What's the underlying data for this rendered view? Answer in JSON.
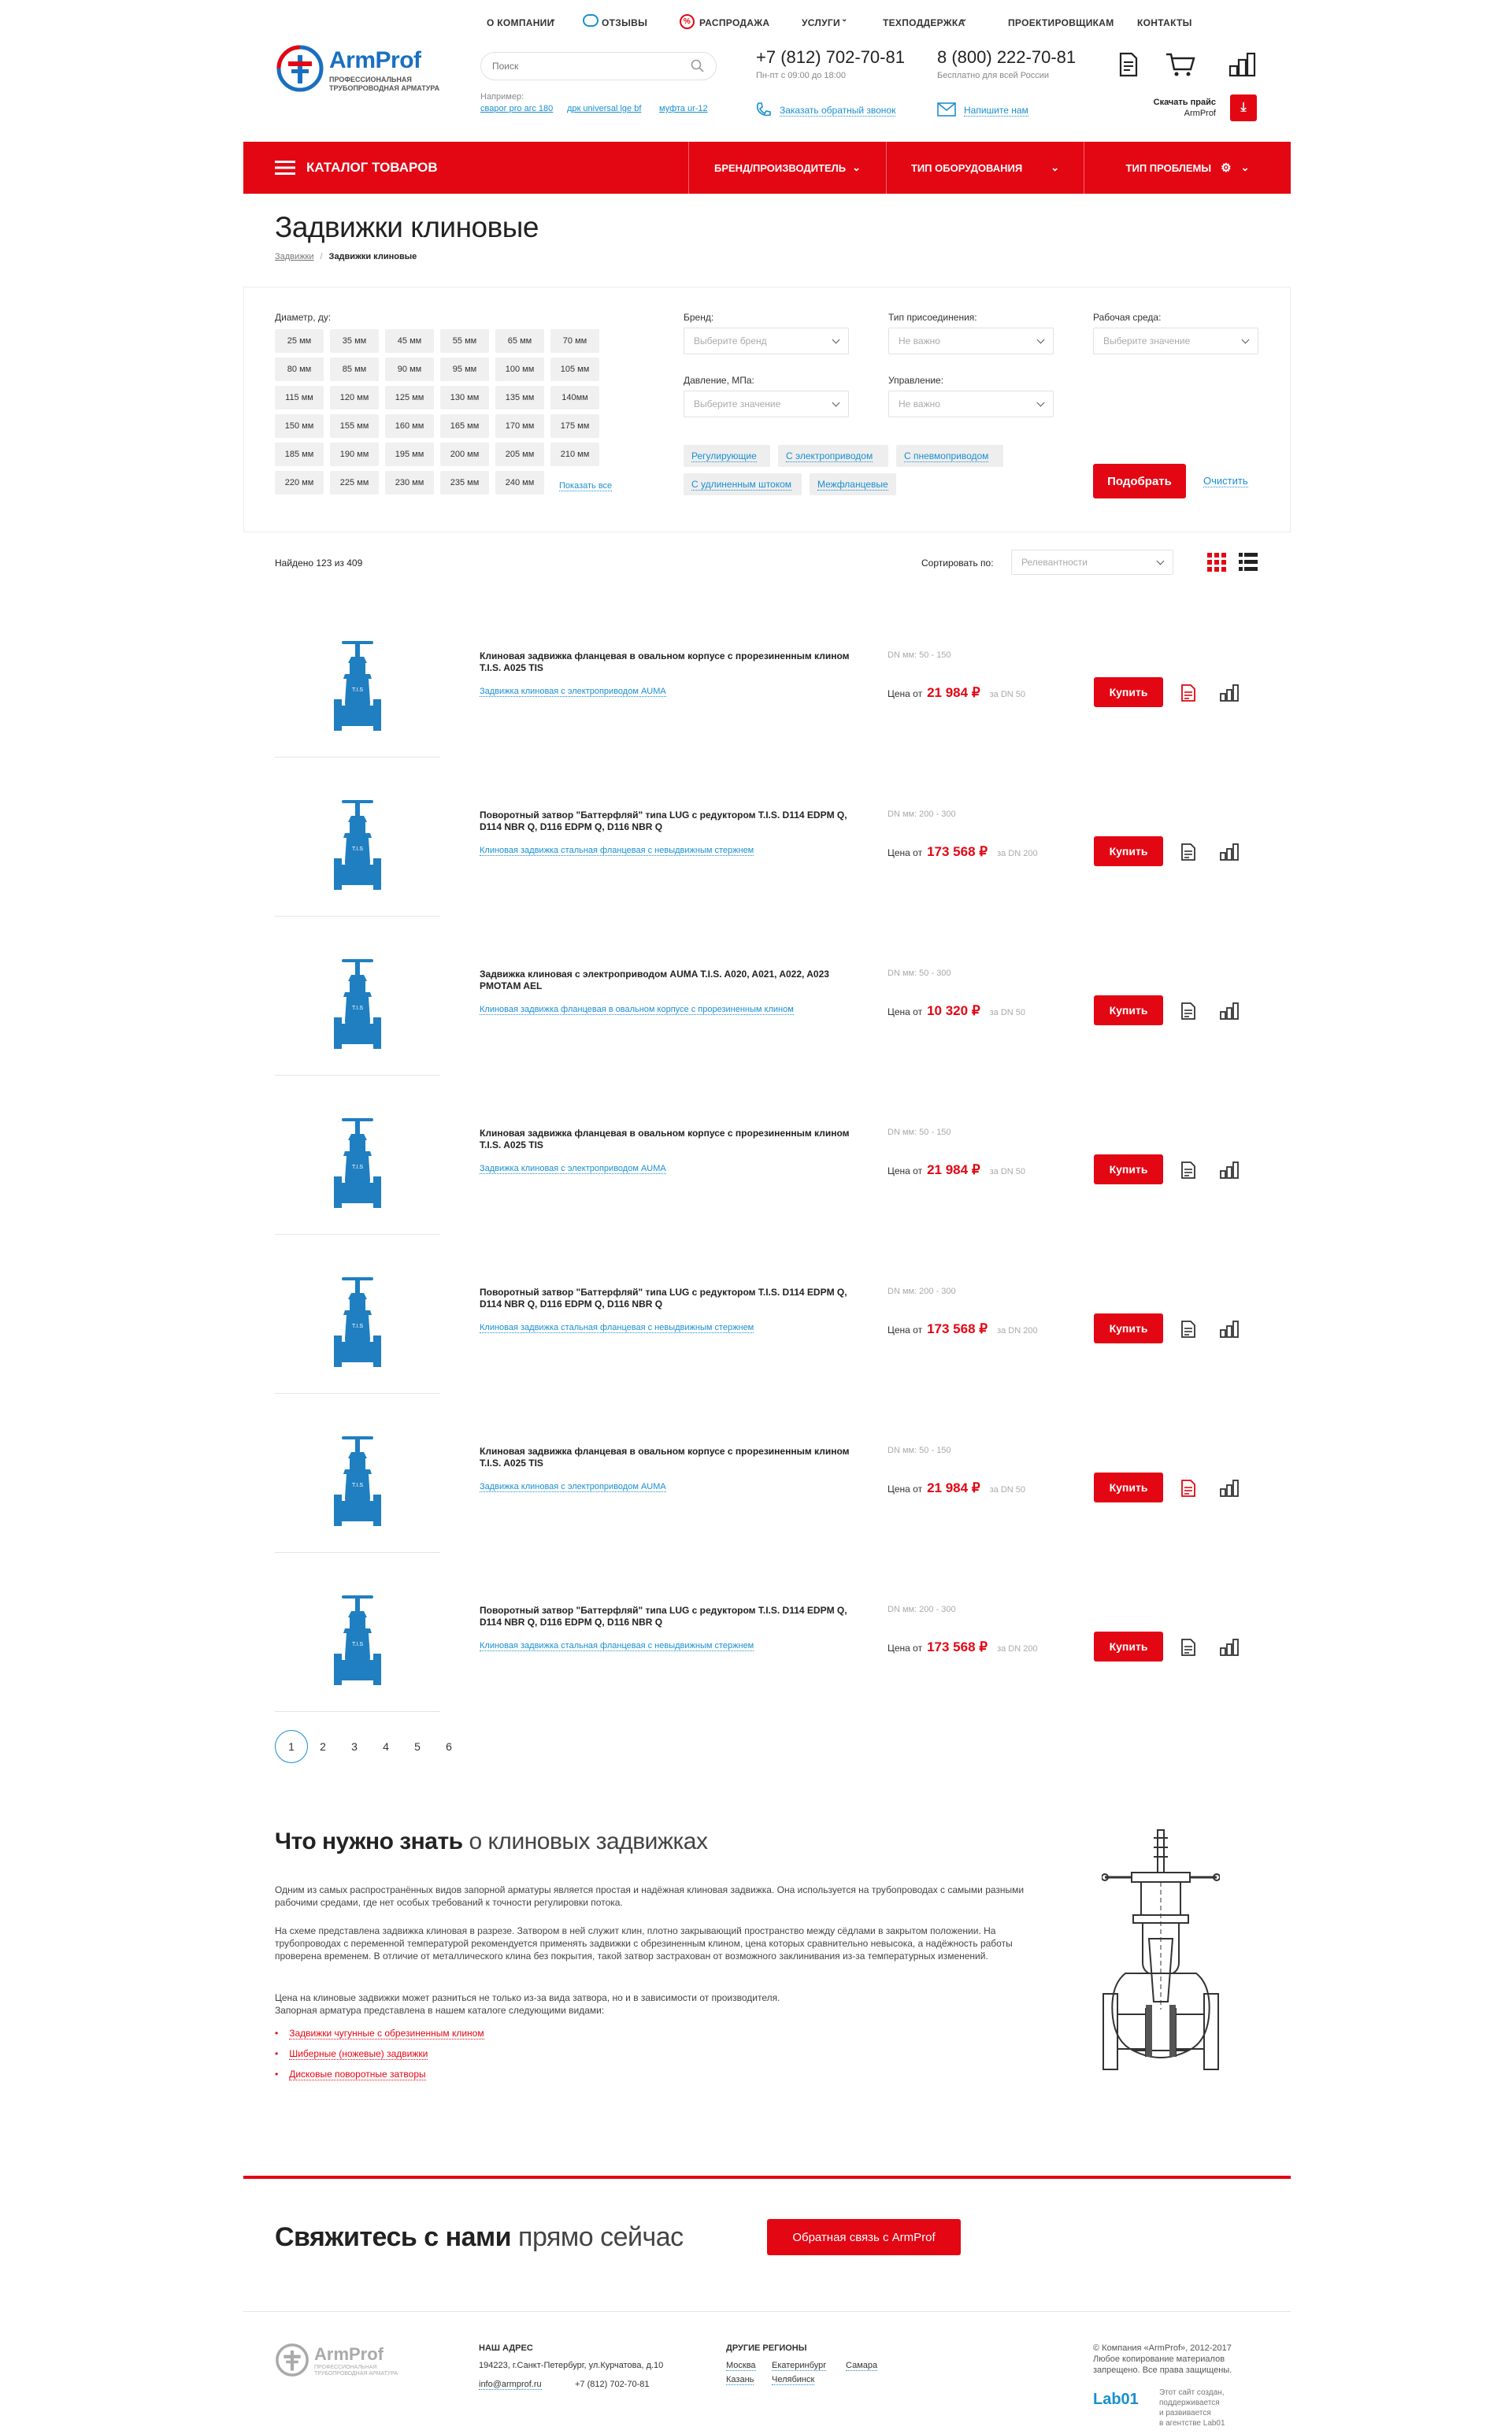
{
  "header": {
    "logo_text": "ArmProf",
    "logo_tagline_1": "ПРОФЕССИОНАЛЬНАЯ",
    "logo_tagline_2": "ТРУБОПРОВОДНАЯ АРМАТУРА",
    "topnav": [
      "О КОМПАНИИ",
      "ОТЗЫВЫ",
      "РАСПРОДАЖА",
      "УСЛУГИ",
      "ТЕХПОДДЕРЖКА",
      "ПРОЕКТИРОВЩИКАМ",
      "КОНТАКТЫ"
    ],
    "search_placeholder": "Поиск",
    "search_example_label": "Например:",
    "search_examples": [
      "сварог pro arc 180",
      "дрк universal lge bf",
      "муфта ur-12"
    ],
    "phone1": "+7 (812) 702-70-81",
    "phone1_hours": "Пн-пт с 09:00 до 18:00",
    "phone2": "8 (800) 222-70-81",
    "phone2_note": "Бесплатно для всей России",
    "callback": "Заказать обратный звонок",
    "write_us": "Напишите нам",
    "pricelist_1": "Скачать прайс",
    "pricelist_2": "ArmProf"
  },
  "menubar": {
    "catalog": "КАТАЛОГ ТОВАРОВ",
    "brand": "БРЕНД/ПРОИЗВОДИТЕЛЬ",
    "equipment": "ТИП ОБОРУДОВАНИЯ",
    "problem": "ТИП ПРОБЛЕМЫ"
  },
  "page": {
    "title": "Задвижки клиновые",
    "breadcrumb_1": "Задвижки",
    "breadcrumb_sep": "/",
    "breadcrumb_2": "Задвижки клиновые"
  },
  "filter": {
    "diameter_label": "Диаметр, ду:",
    "diameters": [
      "25 мм",
      "35 мм",
      "45 мм",
      "55 мм",
      "65 мм",
      "70 мм",
      "80 мм",
      "85 мм",
      "90 мм",
      "95 мм",
      "100 мм",
      "105 мм",
      "115 мм",
      "120 мм",
      "125 мм",
      "130 мм",
      "135 мм",
      "140мм",
      "150 мм",
      "155 мм",
      "160 мм",
      "165 мм",
      "170 мм",
      "175 мм",
      "185 мм",
      "190 мм",
      "195 мм",
      "200 мм",
      "205 мм",
      "210 мм",
      "220 мм",
      "225 мм",
      "230 мм",
      "235 мм",
      "240 мм"
    ],
    "show_all": "Показать все",
    "brand_label": "Бренд:",
    "brand_value": "Выберите бренд",
    "connection_label": "Тип присоединения:",
    "connection_value": "Не важно",
    "medium_label": "Рабочая среда:",
    "medium_value": "Выберите значение",
    "pressure_label": "Давление, МПа:",
    "pressure_value": "Выберите значение",
    "control_label": "Управление:",
    "control_value": "Не важно",
    "tags": [
      "Регулирующие",
      "С электроприводом",
      "С пневмоприводом",
      "С удлиненным штоком",
      "Межфланцевые"
    ],
    "submit": "Подобрать",
    "clear": "Очистить"
  },
  "results": {
    "found": "Найдено 123 из 409",
    "sort_label": "Сортировать по:",
    "sort_value": "Релевантности"
  },
  "products": [
    {
      "name": "Клиновая задвижка фланцевая в овальном корпусе с прорезиненным клином T.I.S. A025 TIS",
      "sub": "Задвижка клиновая с электроприводом AUMA",
      "dn": "DN мм: 50 - 150",
      "price_label": "Цена от",
      "price": "21 984 ₽",
      "per": "за DN 50",
      "buy": "Купить",
      "doc_color": "#e30613"
    },
    {
      "name": "Поворотный затвор \"Баттерфляй\" типа LUG с редуктором T.I.S. D114 EDPM Q, D114 NBR Q, D116 EDPM Q, D116 NBR Q",
      "sub": "Клиновая задвижка стальная фланцевая с невыдвижным стержнем",
      "dn": "DN мм: 200 - 300",
      "price_label": "Цена от",
      "price": "173 568 ₽",
      "per": "за DN 200",
      "buy": "Купить",
      "doc_color": "#333"
    },
    {
      "name": "Задвижка клиновая с электроприводом AUMA T.I.S. A020, A021, A022, A023 PMOTAM AEL",
      "sub": "Клиновая задвижка фланцевая в овальном корпусе с прорезиненным клином",
      "dn": "DN мм: 50 - 300",
      "price_label": "Цена от",
      "price": "10 320 ₽",
      "per": "за DN 50",
      "buy": "Купить",
      "doc_color": "#333"
    },
    {
      "name": "Клиновая задвижка фланцевая в овальном корпусе с прорезиненным клином T.I.S. A025 TIS",
      "sub": "Задвижка клиновая с электроприводом AUMA",
      "dn": "DN мм: 50 - 150",
      "price_label": "Цена от",
      "price": "21 984 ₽",
      "per": "за DN 50",
      "buy": "Купить",
      "doc_color": "#333"
    },
    {
      "name": "Поворотный затвор \"Баттерфляй\" типа LUG с редуктором T.I.S. D114 EDPM Q, D114 NBR Q, D116 EDPM Q, D116 NBR Q",
      "sub": "Клиновая задвижка стальная фланцевая с невыдвижным стержнем",
      "dn": "DN мм: 200 - 300",
      "price_label": "Цена от",
      "price": "173 568 ₽",
      "per": "за DN 200",
      "buy": "Купить",
      "doc_color": "#333"
    },
    {
      "name": "Клиновая задвижка фланцевая в овальном корпусе с прорезиненным клином T.I.S. A025 TIS",
      "sub": "Задвижка клиновая с электроприводом AUMA",
      "dn": "DN мм: 50 - 150",
      "price_label": "Цена от",
      "price": "21 984 ₽",
      "per": "за DN 50",
      "buy": "Купить",
      "doc_color": "#e30613"
    },
    {
      "name": "Поворотный затвор \"Баттерфляй\" типа LUG с редуктором T.I.S. D114 EDPM Q, D114 NBR Q, D116 EDPM Q, D116 NBR Q",
      "sub": "Клиновая задвижка стальная фланцевая с невыдвижным стержнем",
      "dn": "DN мм: 200 - 300",
      "price_label": "Цена от",
      "price": "173 568 ₽",
      "per": "за DN 200",
      "buy": "Купить",
      "doc_color": "#333"
    }
  ],
  "pagination": [
    "1",
    "2",
    "3",
    "4",
    "5",
    "6"
  ],
  "info": {
    "title_bold": "Что нужно знать",
    "title_light": "о клиновых задвижках",
    "p1": "Одним из самых распространённых видов запорной арматуры является простая и надёжная клиновая задвижка. Она используется на трубопроводах с самыми разными рабочими средами, где нет особых требований к точности регулировки потока.",
    "p2": "На схеме представлена задвижка клиновая в разрезе. Затвором в ней служит клин, плотно закрывающий пространство между сёдлами в закрытом положении. На трубопроводах с переменной температурой рекомендуется применять задвижки с обрезиненным клином, цена которых сравнительно невысока, а надёжность работы проверена временем. В отличие от металлического клина без покрытия, такой затвор застрахован от возможного заклинивания из-за температурных изменений.",
    "p3a": "Цена на клиновые задвижки может разниться не только из-за вида затвора, но и в зависимости от производителя.",
    "p3b": "Запорная арматура представлена в нашем каталоге следующими видами:",
    "links": [
      "Задвижки чугунные с обрезиненным клином",
      "Шиберные (ножевые) задвижки",
      "Дисковые поворотные затворы"
    ]
  },
  "contact": {
    "title_bold": "Свяжитесь с нами",
    "title_light": "прямо сейчас",
    "button": "Обратная связь с ArmProf"
  },
  "footer": {
    "logo_text": "ArmProf",
    "logo_tagline_1": "ПРОФЕССИОНАЛЬНАЯ",
    "logo_tagline_2": "ТРУБОПРОВОДНАЯ АРМАТУРА",
    "address_title": "НАШ АДРЕС",
    "address": "194223, г.Санкт-Петербург, ул.Курчатова, д.10",
    "email": "info@armprof.ru",
    "phone": "+7 (812) 702-70-81",
    "regions_title": "ДРУГИЕ РЕГИОНЫ",
    "regions_row1": [
      "Москва",
      "Екатеринбург",
      "Самара"
    ],
    "regions_row2": [
      "Казань",
      "Челябинск"
    ],
    "copyright_1": "© Компания «ArmProf», 2012-2017",
    "copyright_2": "Любое копирование материалов",
    "copyright_3": "запрещено. Все права защищены.",
    "lab_logo": "Lab01",
    "lab_1": "Этот сайт создан,",
    "lab_2": "поддерживается",
    "lab_3": "и развивается",
    "lab_4": "в агентстве Lab01"
  },
  "colors": {
    "accent": "#e30613",
    "link": "#1a8fd0",
    "valve": "#1f7fc1"
  }
}
